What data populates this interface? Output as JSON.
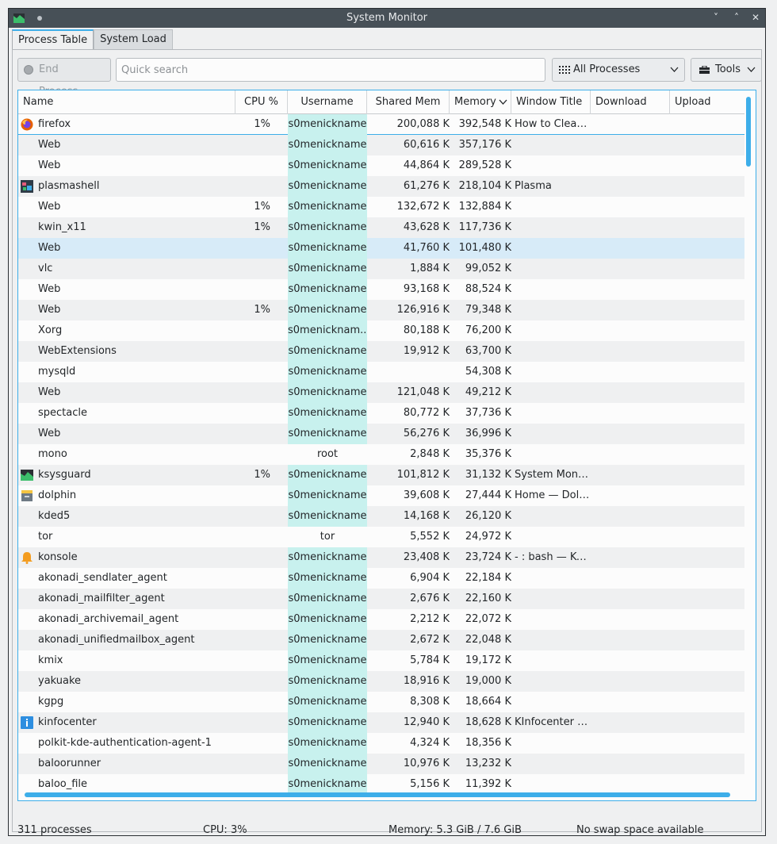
{
  "window": {
    "title": "System Monitor",
    "minimize": "˅",
    "maximize": "˄",
    "close": "✕"
  },
  "tabs": [
    {
      "label": "Process Table"
    },
    {
      "label": "System Load"
    }
  ],
  "toolbar": {
    "end_process": "End Process...",
    "search_placeholder": "Quick search",
    "filter": "All Processes",
    "tools": "Tools"
  },
  "columns": {
    "name": "Name",
    "cpu": "CPU %",
    "username": "Username",
    "shared": "Shared Mem",
    "memory": "Memory",
    "window_title": "Window Title",
    "download": "Download",
    "upload": "Upload"
  },
  "rows": [
    {
      "name": "firefox",
      "cpu": "1%",
      "user": "s0menickname",
      "shared": "200,088 K",
      "mem": "392,548 K",
      "win": "How to Clear ...",
      "icon": "firefox-icon"
    },
    {
      "name": "Web",
      "cpu": "",
      "user": "s0menickname",
      "shared": "60,616 K",
      "mem": "357,176 K",
      "win": ""
    },
    {
      "name": "Web",
      "cpu": "",
      "user": "s0menickname",
      "shared": "44,864 K",
      "mem": "289,528 K",
      "win": ""
    },
    {
      "name": "plasmashell",
      "cpu": "",
      "user": "s0menickname",
      "shared": "61,276 K",
      "mem": "218,104 K",
      "win": "Plasma",
      "icon": "plasma-icon"
    },
    {
      "name": "Web",
      "cpu": "1%",
      "user": "s0menickname",
      "shared": "132,672 K",
      "mem": "132,884 K",
      "win": ""
    },
    {
      "name": "kwin_x11",
      "cpu": "1%",
      "user": "s0menickname",
      "shared": "43,628 K",
      "mem": "117,736 K",
      "win": ""
    },
    {
      "name": "Web",
      "cpu": "",
      "user": "s0menickname",
      "shared": "41,760 K",
      "mem": "101,480 K",
      "win": "",
      "selected": true
    },
    {
      "name": "vlc",
      "cpu": "",
      "user": "s0menickname",
      "shared": "1,884 K",
      "mem": "99,052 K",
      "win": ""
    },
    {
      "name": "Web",
      "cpu": "",
      "user": "s0menickname",
      "shared": "93,168 K",
      "mem": "88,524 K",
      "win": ""
    },
    {
      "name": "Web",
      "cpu": "1%",
      "user": "s0menickname",
      "shared": "126,916 K",
      "mem": "79,348 K",
      "win": ""
    },
    {
      "name": "Xorg",
      "cpu": "",
      "user": "s0menicknam...",
      "shared": "80,188 K",
      "mem": "76,200 K",
      "win": ""
    },
    {
      "name": "WebExtensions",
      "cpu": "",
      "user": "s0menickname",
      "shared": "19,912 K",
      "mem": "63,700 K",
      "win": ""
    },
    {
      "name": "mysqld",
      "cpu": "",
      "user": "s0menickname",
      "shared": "",
      "mem": "54,308 K",
      "win": ""
    },
    {
      "name": "Web",
      "cpu": "",
      "user": "s0menickname",
      "shared": "121,048 K",
      "mem": "49,212 K",
      "win": ""
    },
    {
      "name": "spectacle",
      "cpu": "",
      "user": "s0menickname",
      "shared": "80,772 K",
      "mem": "37,736 K",
      "win": ""
    },
    {
      "name": "Web",
      "cpu": "",
      "user": "s0menickname",
      "shared": "56,276 K",
      "mem": "36,996 K",
      "win": ""
    },
    {
      "name": "mono",
      "cpu": "",
      "user": "root",
      "shared": "2,848 K",
      "mem": "35,376 K",
      "win": "",
      "plainuser": true
    },
    {
      "name": "ksysguard",
      "cpu": "1%",
      "user": "s0menickname",
      "shared": "101,812 K",
      "mem": "31,132 K",
      "win": "System Monitor",
      "icon": "ksysguard-icon"
    },
    {
      "name": "dolphin",
      "cpu": "",
      "user": "s0menickname",
      "shared": "39,608 K",
      "mem": "27,444 K",
      "win": "Home — Dolp...",
      "icon": "dolphin-icon"
    },
    {
      "name": "kded5",
      "cpu": "",
      "user": "s0menickname",
      "shared": "14,168 K",
      "mem": "26,120 K",
      "win": ""
    },
    {
      "name": "tor",
      "cpu": "",
      "user": "tor",
      "shared": "5,552 K",
      "mem": "24,972 K",
      "win": "",
      "plainuser": true
    },
    {
      "name": "konsole",
      "cpu": "",
      "user": "s0menickname",
      "shared": "23,408 K",
      "mem": "23,724 K",
      "win": "- : bash — Kon...",
      "icon": "konsole-icon"
    },
    {
      "name": "akonadi_sendlater_agent",
      "cpu": "",
      "user": "s0menickname",
      "shared": "6,904 K",
      "mem": "22,184 K",
      "win": ""
    },
    {
      "name": "akonadi_mailfilter_agent",
      "cpu": "",
      "user": "s0menickname",
      "shared": "2,676 K",
      "mem": "22,160 K",
      "win": ""
    },
    {
      "name": "akonadi_archivemail_agent",
      "cpu": "",
      "user": "s0menickname",
      "shared": "2,212 K",
      "mem": "22,072 K",
      "win": ""
    },
    {
      "name": "akonadi_unifiedmailbox_agent",
      "cpu": "",
      "user": "s0menickname",
      "shared": "2,672 K",
      "mem": "22,048 K",
      "win": ""
    },
    {
      "name": "kmix",
      "cpu": "",
      "user": "s0menickname",
      "shared": "5,784 K",
      "mem": "19,172 K",
      "win": ""
    },
    {
      "name": "yakuake",
      "cpu": "",
      "user": "s0menickname",
      "shared": "18,916 K",
      "mem": "19,000 K",
      "win": ""
    },
    {
      "name": "kgpg",
      "cpu": "",
      "user": "s0menickname",
      "shared": "8,308 K",
      "mem": "18,664 K",
      "win": ""
    },
    {
      "name": "kinfocenter",
      "cpu": "",
      "user": "s0menickname",
      "shared": "12,940 K",
      "mem": "18,628 K",
      "win": "KInfocenter —...",
      "icon": "info-icon"
    },
    {
      "name": "polkit-kde-authentication-agent-1",
      "cpu": "",
      "user": "s0menickname",
      "shared": "4,324 K",
      "mem": "18,356 K",
      "win": ""
    },
    {
      "name": "baloorunner",
      "cpu": "",
      "user": "s0menickname",
      "shared": "10,976 K",
      "mem": "13,232 K",
      "win": ""
    },
    {
      "name": "baloo_file",
      "cpu": "",
      "user": "s0menickname",
      "shared": "5,156 K",
      "mem": "11,392 K",
      "win": ""
    }
  ],
  "status": {
    "processes": "311 processes",
    "cpu": "CPU: 3%",
    "memory": "Memory: 5.3 GiB / 7.6 GiB",
    "swap": "No swap space available"
  },
  "colors": {
    "accent": "#3daee9",
    "user_highlight": "#c8f1ee",
    "titlebar": "#475057"
  }
}
